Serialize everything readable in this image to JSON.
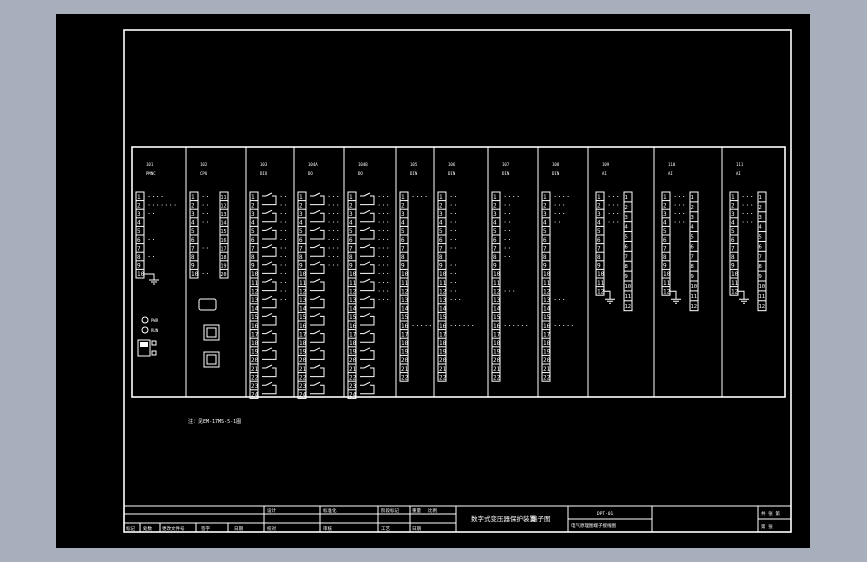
{
  "modules": [
    {
      "id": "m1",
      "header": [
        "101",
        "PMNC"
      ],
      "rows": 10,
      "kind": "short",
      "labels": [
        "• • • •",
        "• • • • • • •",
        "• •",
        "",
        "",
        "• •",
        "",
        "• •",
        "",
        ""
      ]
    },
    {
      "id": "m2",
      "header": [
        "102",
        "CPU"
      ],
      "rows": 10,
      "kind": "double",
      "labels": [
        "• •",
        "• •",
        "• •",
        "• •",
        "",
        "",
        "• •",
        "",
        "",
        "• •"
      ]
    },
    {
      "id": "m3",
      "header": [
        "103",
        "DIO"
      ],
      "rows": 24,
      "kind": "relay",
      "labels": [
        "• •",
        "• •",
        "• •",
        "• •",
        "• •",
        "• •",
        "• •",
        "• •",
        "• •",
        "• •",
        "• •",
        "• •",
        "• •",
        "",
        "",
        "",
        "",
        "",
        "",
        "",
        "",
        "",
        "",
        ""
      ]
    },
    {
      "id": "m4",
      "header": [
        "104A",
        "DO"
      ],
      "rows": 24,
      "kind": "relay",
      "labels": [
        "• • •",
        "• • •",
        "• • •",
        "• • •",
        "• • •",
        "• • •",
        "• • •",
        "• • •",
        "• • •",
        "",
        "",
        "",
        "",
        "",
        "",
        "",
        "",
        "",
        "",
        "",
        "",
        "",
        "",
        ""
      ]
    },
    {
      "id": "m5",
      "header": [
        "104B",
        "DO"
      ],
      "rows": 24,
      "kind": "relay",
      "labels": [
        "• • •",
        "• • •",
        "• • •",
        "• • •",
        "• • •",
        "• • •",
        "• • •",
        "• • •",
        "• • •",
        "• • •",
        "• • •",
        "• • •",
        "• • •",
        "",
        "",
        "",
        "",
        "",
        "",
        "",
        "",
        "",
        "",
        ""
      ]
    },
    {
      "id": "m6",
      "header": [
        "105",
        "DIN"
      ],
      "rows": 22,
      "kind": "input",
      "labels": [
        "• • • •",
        "",
        "",
        "",
        "",
        "",
        "",
        "",
        "",
        "",
        "",
        "",
        "",
        "",
        "",
        "• • • • •",
        "",
        "",
        "",
        "",
        "",
        ""
      ]
    },
    {
      "id": "m7",
      "header": [
        "106",
        "DIN"
      ],
      "rows": 22,
      "kind": "input",
      "labels": [
        "• •",
        "• •",
        "• •",
        "• •",
        "• •",
        "• •",
        "• •",
        "",
        "• •",
        "• •",
        "• •",
        "• •",
        "• • •",
        "",
        "",
        "• • • • • •",
        "",
        "",
        "",
        "",
        "",
        ""
      ]
    },
    {
      "id": "m8",
      "header": [
        "107",
        "DIN"
      ],
      "rows": 22,
      "kind": "input",
      "labels": [
        "• • • •",
        "• •",
        "• •",
        "• •",
        "• •",
        "• •",
        "• •",
        "• •",
        "",
        "",
        "",
        "• • •",
        "",
        "",
        "",
        "• • • • • •",
        "",
        "",
        "",
        "",
        "",
        ""
      ]
    },
    {
      "id": "m9",
      "header": [
        "108",
        "DIN"
      ],
      "rows": 22,
      "kind": "input",
      "labels": [
        "• • • •",
        "• • •",
        "• • •",
        "• •",
        "",
        "",
        "",
        "",
        "",
        "",
        "",
        "",
        "• • •",
        "",
        "",
        "• • • • •",
        "",
        "",
        "",
        "",
        "",
        ""
      ]
    },
    {
      "id": "m10",
      "header": [
        "109",
        "AI"
      ],
      "rows": 12,
      "kind": "ai",
      "labels": [
        "• • •",
        "• • •",
        "• • •",
        "• • •",
        "",
        "",
        "",
        "",
        "",
        "",
        "",
        ""
      ]
    },
    {
      "id": "m11",
      "header": [
        "110",
        "AI"
      ],
      "rows": 12,
      "kind": "ai",
      "labels": [
        "• • •",
        "• • •",
        "• • •",
        "• • •",
        "",
        "",
        "",
        "",
        "",
        "",
        "",
        ""
      ]
    },
    {
      "id": "m12",
      "header": [
        "111",
        "AI"
      ],
      "rows": 12,
      "kind": "ai",
      "labels": [
        "• • •",
        "• • •",
        "• • •",
        "• • •",
        "",
        "",
        "",
        "",
        "",
        "",
        "",
        ""
      ]
    }
  ],
  "indicators": [
    "PWR",
    "RUN"
  ],
  "note": "注：见EM-17MS-5-1图",
  "title_block": {
    "drawing_title": "数字式变压器保护装置",
    "drawing_subtitle": "端子图",
    "drawing_code": "DPT-01",
    "drawing_code_sub": "电气原理图端子接线图",
    "sheet_mark": "共 张 第",
    "sheet_mark2": "第 张",
    "hdr_labels": [
      "标记",
      "处数",
      "更改文件号",
      "签字",
      "日期"
    ],
    "row1": [
      "设计",
      "",
      "标准化",
      "",
      "阶段标记",
      "重量",
      "比例"
    ],
    "row2": [
      "校对",
      "",
      "审核",
      "",
      "工艺",
      "",
      "日期"
    ]
  }
}
